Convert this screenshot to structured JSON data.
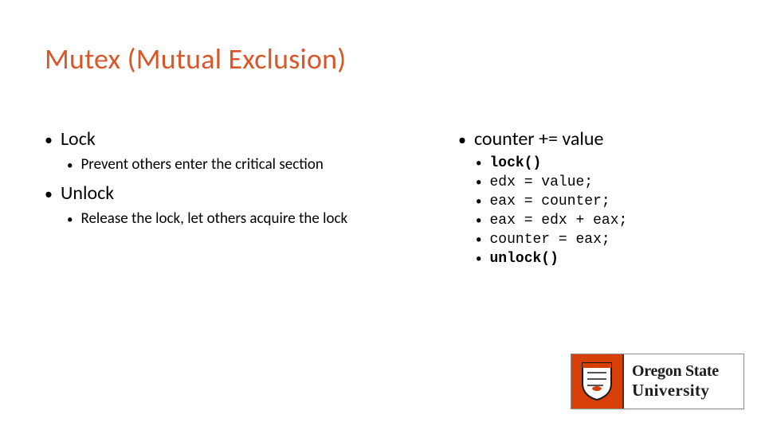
{
  "title": "Mutex (Mutual Exclusion)",
  "left": {
    "item1": "Lock",
    "item1_sub": "Prevent others enter the critical section",
    "item2": "Unlock",
    "item2_sub": "Release the lock, let others acquire the lock"
  },
  "right": {
    "header": "counter += value",
    "code": {
      "l0": "lock()",
      "l1": "edx = value;",
      "l2": "eax = counter;",
      "l3": "eax = edx + eax;",
      "l4": "counter = eax;",
      "l5": "unlock()"
    }
  },
  "logo": {
    "line1": "Oregon State",
    "line2": "University"
  }
}
